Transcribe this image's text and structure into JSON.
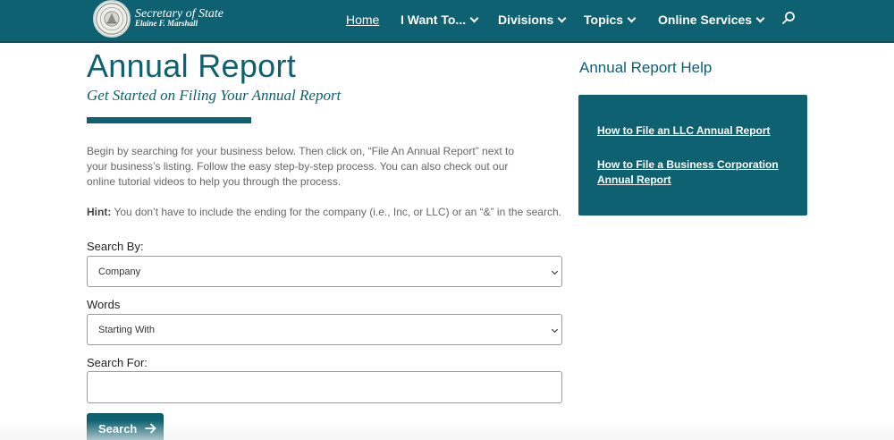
{
  "header": {
    "logo_title": "Secretary of State",
    "logo_subtitle": "Elaine F. Marshall",
    "nav": [
      {
        "label": "Home"
      },
      {
        "label": "I Want To..."
      },
      {
        "label": "Divisions"
      },
      {
        "label": "Topics"
      },
      {
        "label": "Online Services"
      }
    ]
  },
  "main": {
    "title": "Annual Report",
    "subtitle": "Get Started on Filing Your Annual Report",
    "intro": "Begin by searching for your business below. Then click on, “File An Annual Report” next to your business’s listing. Follow the easy step-by-step process. You can also check out our online tutorial videos to help you through the process.",
    "hint_label": "Hint:",
    "hint_text": " You don’t have to include the ending for the company (i.e., Inc, or LLC) or an “&” in the search.",
    "search_by_label": "Search By:",
    "search_by_value": "Company",
    "words_label": "Words",
    "words_value": "Starting With",
    "search_for_label": "Search For:",
    "search_for_value": "",
    "submit_label": "Search"
  },
  "sidebar": {
    "title": "Annual Report Help",
    "links": [
      {
        "label": "How to File an LLC Annual Report"
      },
      {
        "label": "How to File a Business Corporation Annual Report"
      }
    ]
  },
  "colors": {
    "brand": "#0d6170",
    "background": "#ffffff"
  },
  "icons": {
    "seal": "state-seal-icon",
    "search": "search-icon",
    "chevron": "chevron-down-icon",
    "arrow": "arrow-right-icon"
  }
}
